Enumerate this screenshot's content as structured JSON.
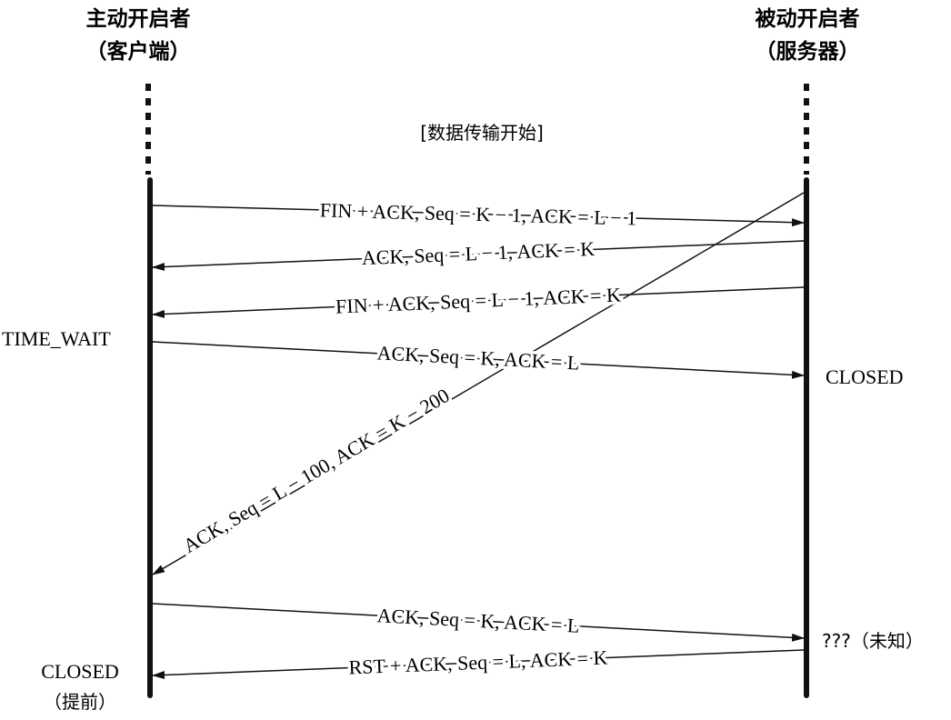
{
  "client": {
    "title": "主动开启者",
    "subtitle": "（客户端）"
  },
  "server": {
    "title": "被动开启者",
    "subtitle": "（服务器）"
  },
  "banner": "[数据传输开始]",
  "messages": [
    {
      "id": "msg-fin-ack-client",
      "label": "FIN + ACK, Seq = K − 1, ACK = L − 1"
    },
    {
      "id": "msg-ack-server",
      "label": "ACK, Seq = L − 1, ACK = K"
    },
    {
      "id": "msg-fin-ack-server",
      "label": "FIN + ACK, Seq = L − 1, ACK = K"
    },
    {
      "id": "msg-ack-client",
      "label": "ACK, Seq = K, ACK = L"
    },
    {
      "id": "msg-delayed-ack",
      "label": "ACK, Seq = L − 100, ACK = K − 200"
    },
    {
      "id": "msg-ack-client-2",
      "label": "ACK, Seq = K, ACK = L"
    },
    {
      "id": "msg-rst-ack",
      "label": "RST + ACK, Seq = L, ACK = K"
    }
  ],
  "states": {
    "time_wait": "TIME_WAIT",
    "server_closed": "CLOSED",
    "unknown": "???（未知）",
    "client_closed": "CLOSED",
    "client_closed_note": "（提前）"
  }
}
